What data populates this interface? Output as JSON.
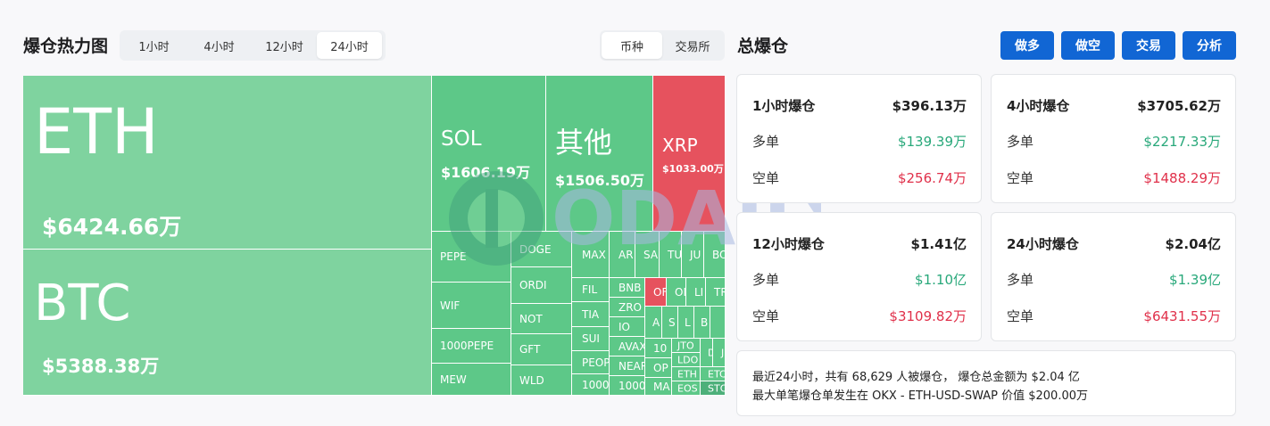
{
  "header": {
    "title": "爆仓热力图",
    "time_tabs": [
      "1小时",
      "4小时",
      "12小时",
      "24小时"
    ],
    "active_time_tab": "24小时",
    "type_tabs": [
      "币种",
      "交易所"
    ],
    "active_type_tab": "币种"
  },
  "treemap": {
    "eth": {
      "name": "ETH",
      "value": "$6424.66万"
    },
    "btc": {
      "name": "BTC",
      "value": "$5388.38万"
    },
    "sol": {
      "name": "SOL",
      "value": "$1606.19万"
    },
    "other": {
      "name": "其他",
      "value": "$1506.50万"
    },
    "xrp": {
      "name": "XRP",
      "value": "$1033.00万"
    },
    "small": [
      "PEPE",
      "WIF",
      "1000PEPE",
      "MEW",
      "DOGE",
      "ORDI",
      "NOT",
      "GFT",
      "WLD",
      "MAX",
      "FIL",
      "TIA",
      "SUI",
      "PEOP",
      "1000S",
      "AR",
      "SA",
      "TU",
      "JU",
      "BO",
      "BNB",
      "ZRO",
      "IO",
      "AVAX",
      "NEAR",
      "1000F",
      "OF",
      "OM",
      "LI",
      "TR",
      "A",
      "S",
      "L",
      "B",
      "10",
      "OP",
      "MA",
      "JTO",
      "LDO",
      "ETH",
      "EOS",
      "D",
      "J",
      "ETC",
      "STO"
    ]
  },
  "watermark": "ODAILY",
  "right": {
    "title": "总爆仓",
    "buttons": [
      "做多",
      "做空",
      "交易",
      "分析"
    ],
    "cards": [
      {
        "label": "1小时爆仓",
        "total": "$396.13万",
        "long_label": "多单",
        "long": "$139.39万",
        "short_label": "空单",
        "short": "$256.74万"
      },
      {
        "label": "4小时爆仓",
        "total": "$3705.62万",
        "long_label": "多单",
        "long": "$2217.33万",
        "short_label": "空单",
        "short": "$1488.29万"
      },
      {
        "label": "12小时爆仓",
        "total": "$1.41亿",
        "long_label": "多单",
        "long": "$1.10亿",
        "short_label": "空单",
        "short": "$3109.82万"
      },
      {
        "label": "24小时爆仓",
        "total": "$2.04亿",
        "long_label": "多单",
        "long": "$1.39亿",
        "short_label": "空单",
        "short": "$6431.55万"
      }
    ],
    "summary_line1": "最近24小时，共有 68,629 人被爆仓， 爆仓总金额为 $2.04 亿",
    "summary_line2": "最大单笔爆仓单发生在 OKX - ETH-USD-SWAP 价值 $200.00万"
  },
  "colors": {
    "long_green": "#28a87a",
    "short_red": "#e0304a",
    "button_blue": "#1166d4",
    "cell_green": "#5dc888",
    "cell_red": "#e6525e"
  }
}
